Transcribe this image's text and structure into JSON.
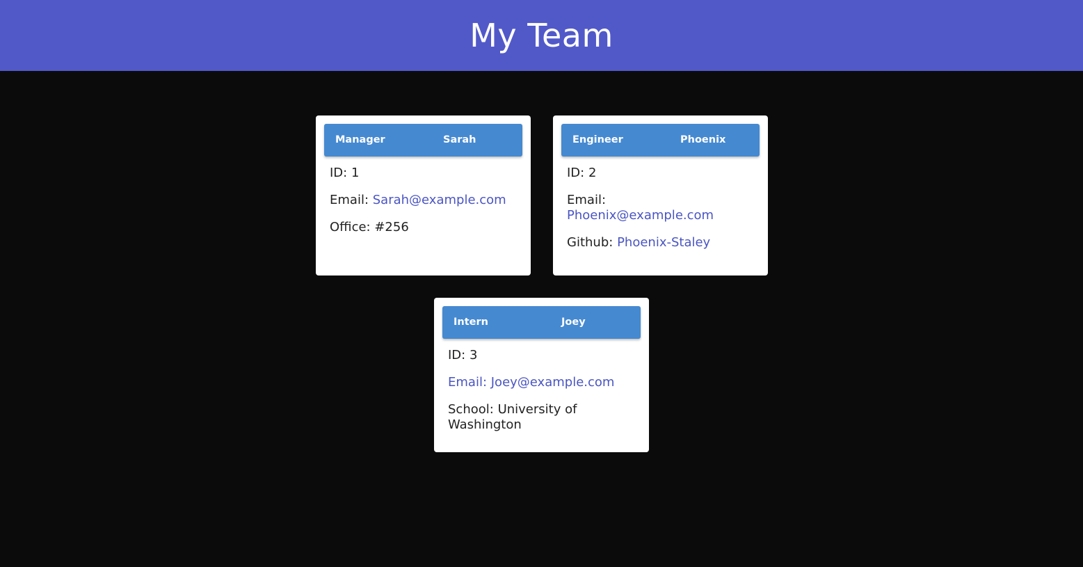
{
  "page": {
    "title": "My Team"
  },
  "colors": {
    "header_bg": "#5159c9",
    "card_header_bg": "#4589d1",
    "page_bg": "#0b0b0b",
    "link": "#4a55c2"
  },
  "team": [
    {
      "role": "Manager",
      "name": "Sarah",
      "id_text": "ID: 1",
      "email_label": "Email:",
      "email": "Sarah@example.com",
      "extra_label": "Office:",
      "extra_value": "#256"
    },
    {
      "role": "Engineer",
      "name": "Phoenix",
      "id_text": "ID: 2",
      "email_label": "Email:",
      "email": "Phoenix@example.com",
      "extra_label": "Github:",
      "extra_value": "Phoenix-Staley"
    },
    {
      "role": "Intern",
      "name": "Joey",
      "id_text": "ID: 3",
      "email_label": "Email:",
      "email": "Joey@example.com",
      "extra_label": "School:",
      "extra_value": "University of Washington"
    }
  ]
}
